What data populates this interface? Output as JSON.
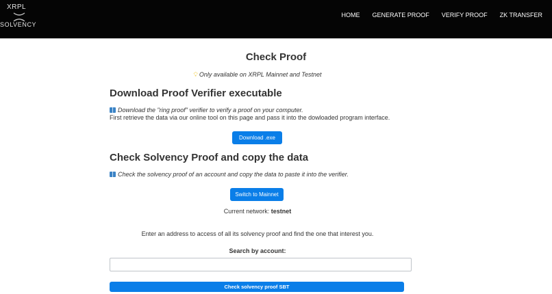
{
  "logo": {
    "top_text": "XRPL",
    "bottom_text": "SOLVENCY"
  },
  "nav": {
    "items": [
      {
        "label": "HOME"
      },
      {
        "label": "GENERATE PROOF"
      },
      {
        "label": "VERIFY PROOF"
      },
      {
        "label": "ZK TRANSFER"
      }
    ]
  },
  "page": {
    "title": "Check Proof",
    "availability_icon": "lightbulb-icon",
    "availability": "Only available on XRPL Mainnet and Testnet"
  },
  "download_section": {
    "heading": "Download Proof Verifier executable",
    "desc_icon": "book-icon",
    "desc_line1": "Download the \"ring proof\" verifier to verify a proof on your computer.",
    "desc_line2": "First retrieve the data via our online tool on this page and pass it into the dowloaded program interface.",
    "button_label": "Download .exe"
  },
  "check_section": {
    "heading": "Check Solvency Proof and copy the data",
    "desc_icon": "book-icon",
    "desc": "Check the solvency proof of an account and copy the data to paste it into the verifier.",
    "switch_button_label": "Switch to Mainnet",
    "network_label": "Current network:",
    "network_value": "testnet"
  },
  "search": {
    "instructions": "Enter an address to access of all its solvency proof and find the one that interest you.",
    "label": "Search by account:",
    "value": "",
    "placeholder": "",
    "submit_label": "Check solvency proof SBT"
  },
  "colors": {
    "navbar": "#050505",
    "accent": "#0a7ee8"
  }
}
